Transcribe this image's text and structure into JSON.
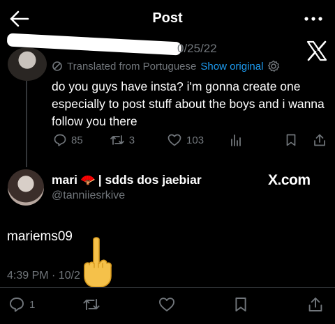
{
  "header": {
    "title": "Post",
    "back_icon": "arrow-left-icon",
    "more_icon": "more-horizontal-icon"
  },
  "original_tweet": {
    "date_partial": "0/25/22",
    "translated_label": "Translated from Portuguese",
    "show_original_label": "Show original",
    "text": "do you guys have insta? i'm gonna create one especially to post stuff about the boys and i wanna follow you there",
    "reply_count": "85",
    "retweet_count": "3",
    "like_count": "103"
  },
  "reply_tweet": {
    "display_name_part1": "mari",
    "display_name_emoji": "🪭",
    "display_name_part2": "| sdds dos jaebiar",
    "handle": "@tanniiesrkive",
    "text": "mariems09",
    "timestamp": "4:39 PM · 10/2",
    "reply_count": "1"
  },
  "watermark": {
    "text": "X.com"
  },
  "overlay": {
    "emoji": "🖕"
  },
  "colors": {
    "background": "#000000",
    "accent": "#1d9bf0",
    "muted": "#71767b",
    "text": "#ffffff"
  }
}
